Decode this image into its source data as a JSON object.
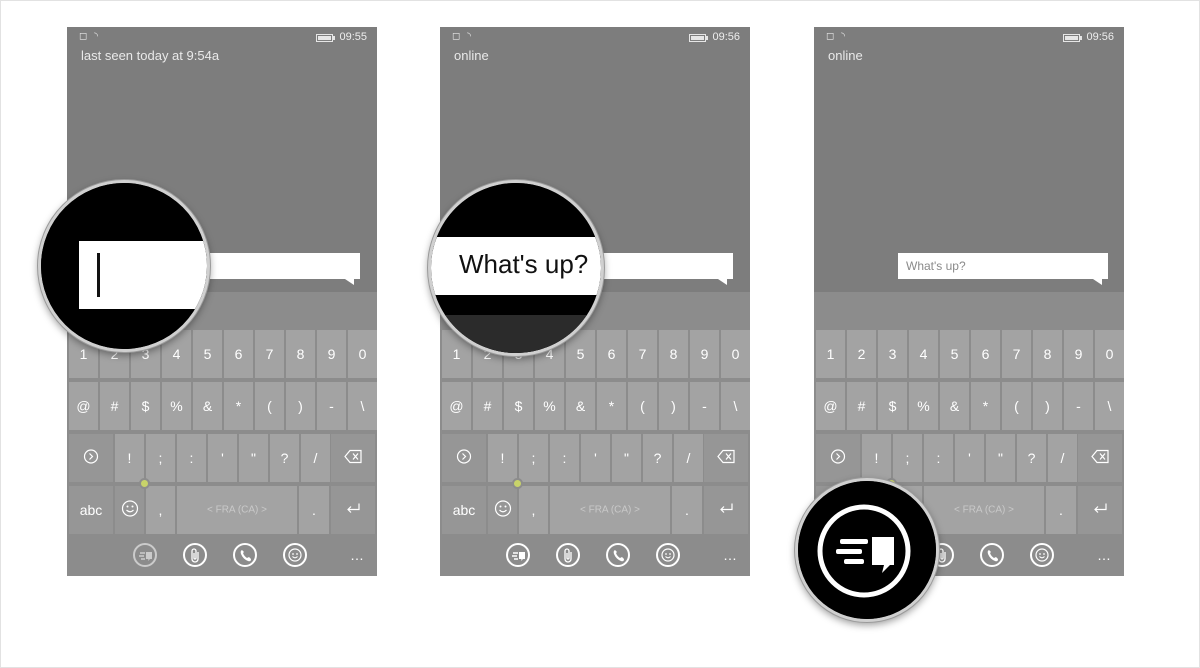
{
  "panels": [
    {
      "time": "09:55",
      "presence": "last seen today at 9:54a",
      "message_box_text": "",
      "lang_label": "< FRA (CA) >"
    },
    {
      "time": "09:56",
      "presence": "online",
      "message_box_text": "",
      "lang_label": "< FRA (CA) >"
    },
    {
      "time": "09:56",
      "presence": "online",
      "message_box_text": "What's up?",
      "lang_label": "< FRA (CA) >"
    }
  ],
  "keyboard": {
    "row1": [
      "1",
      "2",
      "3",
      "4",
      "5",
      "6",
      "7",
      "8",
      "9",
      "0"
    ],
    "row2": [
      "@",
      "#",
      "$",
      "%",
      "&",
      "*",
      "(",
      ")",
      "-",
      "\\"
    ],
    "row3": [
      "!",
      ";",
      ":",
      "'",
      "\"",
      "?",
      "/"
    ],
    "row4_abc": "abc",
    "row4_comma": ",",
    "row4_period": "."
  },
  "zoom_text": "What's up?",
  "more_dots": "…",
  "icons": [
    "wifi-icon",
    "battery-icon",
    "next-icon",
    "backspace-icon",
    "emoji-icon",
    "enter-icon",
    "send-icon",
    "attach-icon",
    "call-icon",
    "smiley-icon"
  ],
  "colors": {
    "phone_bg": "#7d7d7d",
    "keyboard_bg": "#8c8c8c",
    "key_bg": "#a3a3a3",
    "accent_dot": "#c8d36a"
  }
}
